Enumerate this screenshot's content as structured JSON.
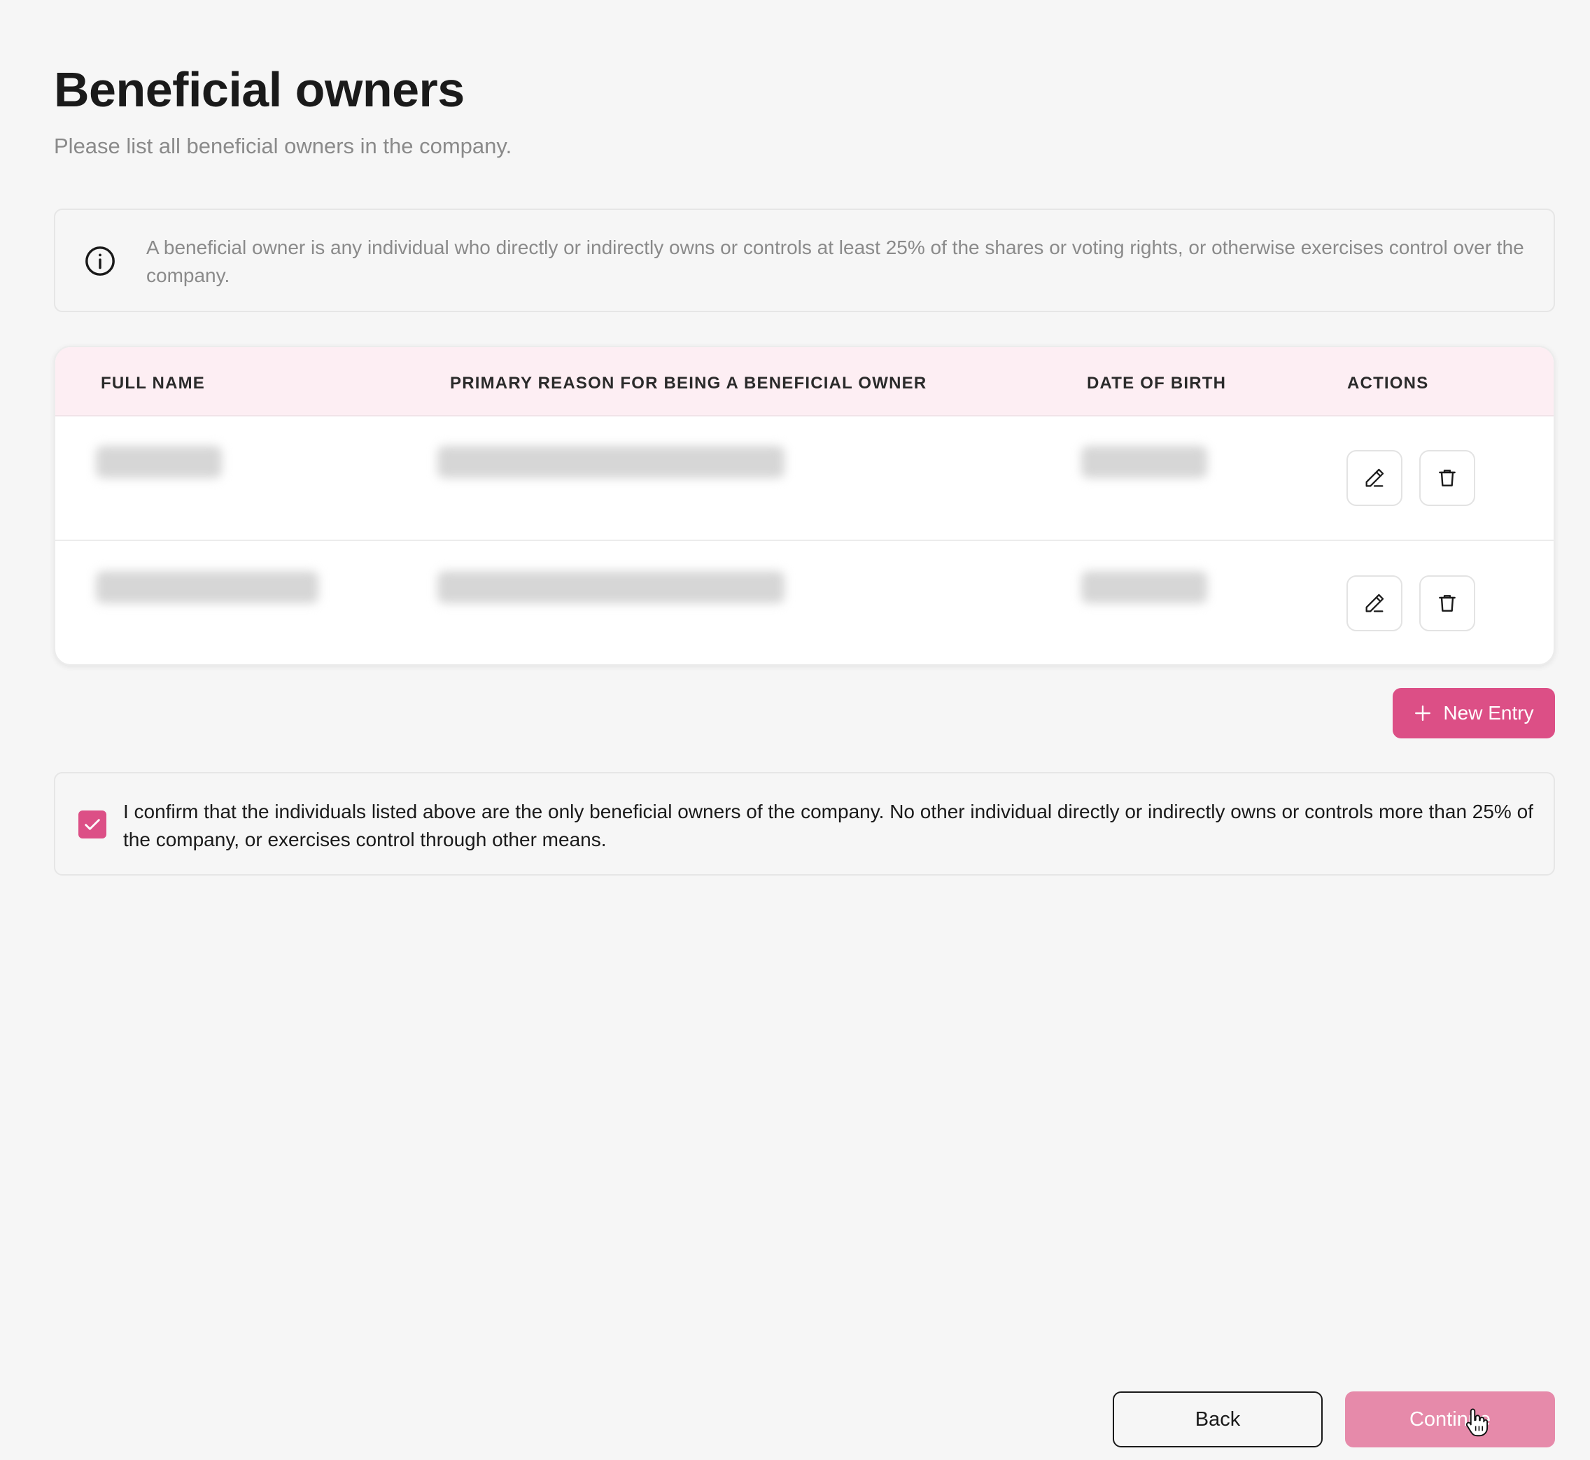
{
  "header": {
    "title": "Beneficial owners",
    "subtitle": "Please list all beneficial owners in the company."
  },
  "info": {
    "icon": "info-circle-icon",
    "text": "A beneficial owner is any individual who directly or indirectly owns or controls at least 25% of the shares or voting rights, or otherwise exercises control over the company."
  },
  "table": {
    "columns": [
      "FULL NAME",
      "PRIMARY REASON FOR BEING A BENEFICIAL OWNER",
      "DATE OF BIRTH",
      "ACTIONS"
    ],
    "row_count": 2,
    "rows_redacted": true,
    "action_icons": [
      "pencil-icon",
      "trash-icon"
    ]
  },
  "actions": {
    "new_entry_label": "New Entry"
  },
  "confirmation": {
    "checked": true,
    "text": "I confirm that the individuals listed above are the only beneficial owners of the company. No other individual directly or indirectly owns or controls more than 25% of the company, or exercises control through other means."
  },
  "footer": {
    "back_label": "Back",
    "continue_label": "Continue"
  },
  "colors": {
    "accent": "#dc4f86",
    "accent_disabled": "#e68aaa",
    "table_header_bg": "#fdeef3",
    "page_bg": "#f6f6f6"
  }
}
